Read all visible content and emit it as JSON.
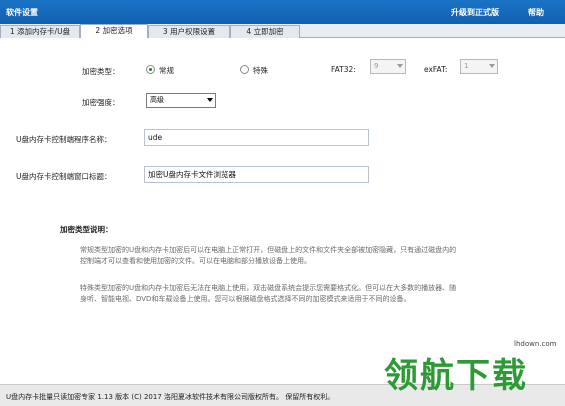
{
  "titlebar": {
    "title": "软件设置",
    "upgrade_label": "升级到正式版",
    "help_label": "帮助"
  },
  "tabs": [
    {
      "label": "1 添加内存卡/U盘",
      "active": false
    },
    {
      "label": "2 加密选项",
      "active": true
    },
    {
      "label": "3 用户权限设置",
      "active": false
    },
    {
      "label": "4 立即加密",
      "active": false
    }
  ],
  "encryption": {
    "type_label": "加密类型：",
    "option_normal": "常规",
    "option_special": "特殊",
    "selected": "常规",
    "fat32_label": "FAT32:",
    "fat32_value": "9",
    "exfat_label": "exFAT:",
    "exfat_value": "1",
    "strength_label": "加密强度：",
    "strength_value": "高级",
    "program_name_label": "U盘内存卡控制端程序名称：",
    "program_name_value": "ude",
    "window_title_label": "U盘内存卡控制端窗口标题：",
    "window_title_value": "加密U盘内存卡文件浏览器"
  },
  "description": {
    "title": "加密类型说明：",
    "normal_text": "常规类型加密的U盘和内存卡加密后可以在电脑上正常打开，但磁盘上的文件和文件夹全部被加密隐藏，只有通过磁盘内的控制端才可以查看和使用加密的文件。可以在电脑和部分播放设备上使用。",
    "special_text": "特殊类型加密的U盘和内存卡加密后无法在电脑上使用，双击磁盘系统会提示您需要格式化。但可以在大多数的播放器、随身听、智能电视、DVD和车载设备上使用。您可以根据磁盘格式选择不同的加密模式来适用于不同的设备。"
  },
  "statusbar": {
    "text": "U盘内存卡批量只读加密专家 1.13 版本 (C) 2017 洛阳夏冰软件技术有限公司版权所有。 保留所有权利。"
  },
  "watermark": {
    "text": "领航下载",
    "url": "lhdown.com"
  },
  "colors": {
    "titlebar": "#1a6fc4",
    "watermark": "#2e9a35"
  }
}
